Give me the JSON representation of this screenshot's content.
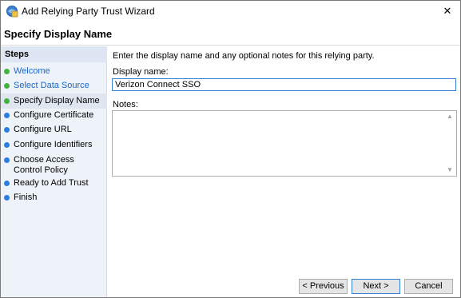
{
  "window": {
    "title": "Add Relying Party Trust Wizard",
    "close_glyph": "✕"
  },
  "header": {
    "title": "Specify Display Name"
  },
  "steps": {
    "heading": "Steps",
    "items": [
      {
        "label": "Welcome",
        "state": "done"
      },
      {
        "label": "Select Data Source",
        "state": "done"
      },
      {
        "label": "Specify Display Name",
        "state": "current"
      },
      {
        "label": "Configure Certificate",
        "state": "pending"
      },
      {
        "label": "Configure URL",
        "state": "pending"
      },
      {
        "label": "Configure Identifiers",
        "state": "pending"
      },
      {
        "label": "Choose Access Control Policy",
        "state": "pending"
      },
      {
        "label": "Ready to Add Trust",
        "state": "pending"
      },
      {
        "label": "Finish",
        "state": "pending"
      }
    ]
  },
  "colors": {
    "done_dot": "#3fb43f",
    "current_dot": "#3fb43f",
    "pending_dot": "#2b7de0",
    "link": "#1a66c9"
  },
  "content": {
    "instruction": "Enter the display name and any optional notes for this relying party.",
    "display_name_label": "Display name:",
    "display_name_value": "Verizon Connect SSO",
    "notes_label": "Notes:",
    "notes_value": ""
  },
  "buttons": {
    "previous": "< Previous",
    "next": "Next >",
    "cancel": "Cancel"
  }
}
